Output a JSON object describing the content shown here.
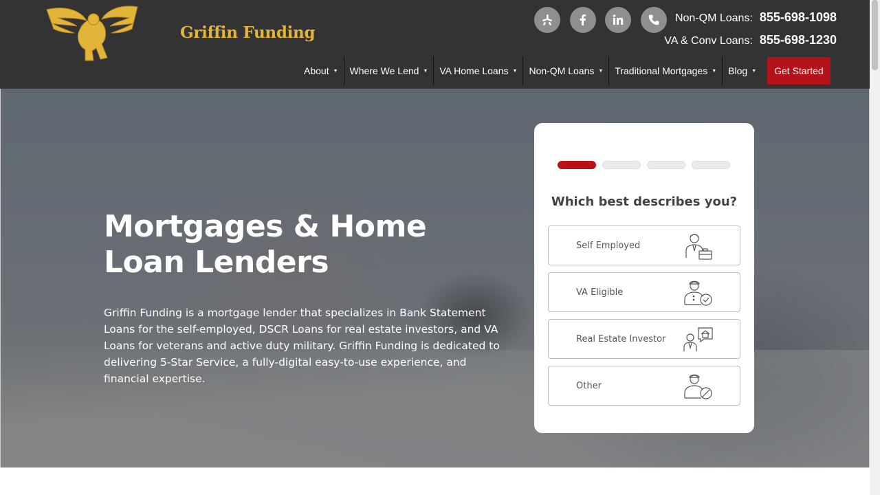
{
  "brand": {
    "name": "Griffin Funding",
    "gold": "#e2b43a"
  },
  "header": {
    "social": [
      {
        "name": "yelp-icon"
      },
      {
        "name": "facebook-icon"
      },
      {
        "name": "linkedin-icon"
      },
      {
        "name": "phone-icon"
      }
    ],
    "phones": [
      {
        "label": "Non-QM Loans:",
        "number": "855-698-1098"
      },
      {
        "label": "VA & Conv Loans:",
        "number": "855-698-1230"
      }
    ],
    "nav": [
      {
        "label": "About"
      },
      {
        "label": "Where We Lend"
      },
      {
        "label": "VA Home Loans"
      },
      {
        "label": "Non-QM Loans"
      },
      {
        "label": "Traditional Mortgages"
      },
      {
        "label": "Blog"
      }
    ],
    "cta": "Get Started",
    "cta_color": "#b5121b"
  },
  "hero": {
    "title_line1": "Mortgages & Home",
    "title_line2": "Loan Lenders",
    "text": "Griffin Funding is a mortgage lender that specializes in Bank Statement Loans for the self-employed, DSCR Loans for real estate investors, and VA Loans for veterans and active duty military. Griffin Funding is dedicated to delivering 5-Star Service, a fully-digital easy-to-use experience, and financial expertise."
  },
  "quiz": {
    "step": 1,
    "total_steps": 4,
    "question": "Which best describes you?",
    "options": [
      {
        "label": "Self Employed",
        "icon": "self-employed-icon"
      },
      {
        "label": "VA Eligible",
        "icon": "va-eligible-icon"
      },
      {
        "label": "Real Estate Investor",
        "icon": "investor-icon"
      },
      {
        "label": "Other",
        "icon": "other-icon"
      }
    ]
  }
}
